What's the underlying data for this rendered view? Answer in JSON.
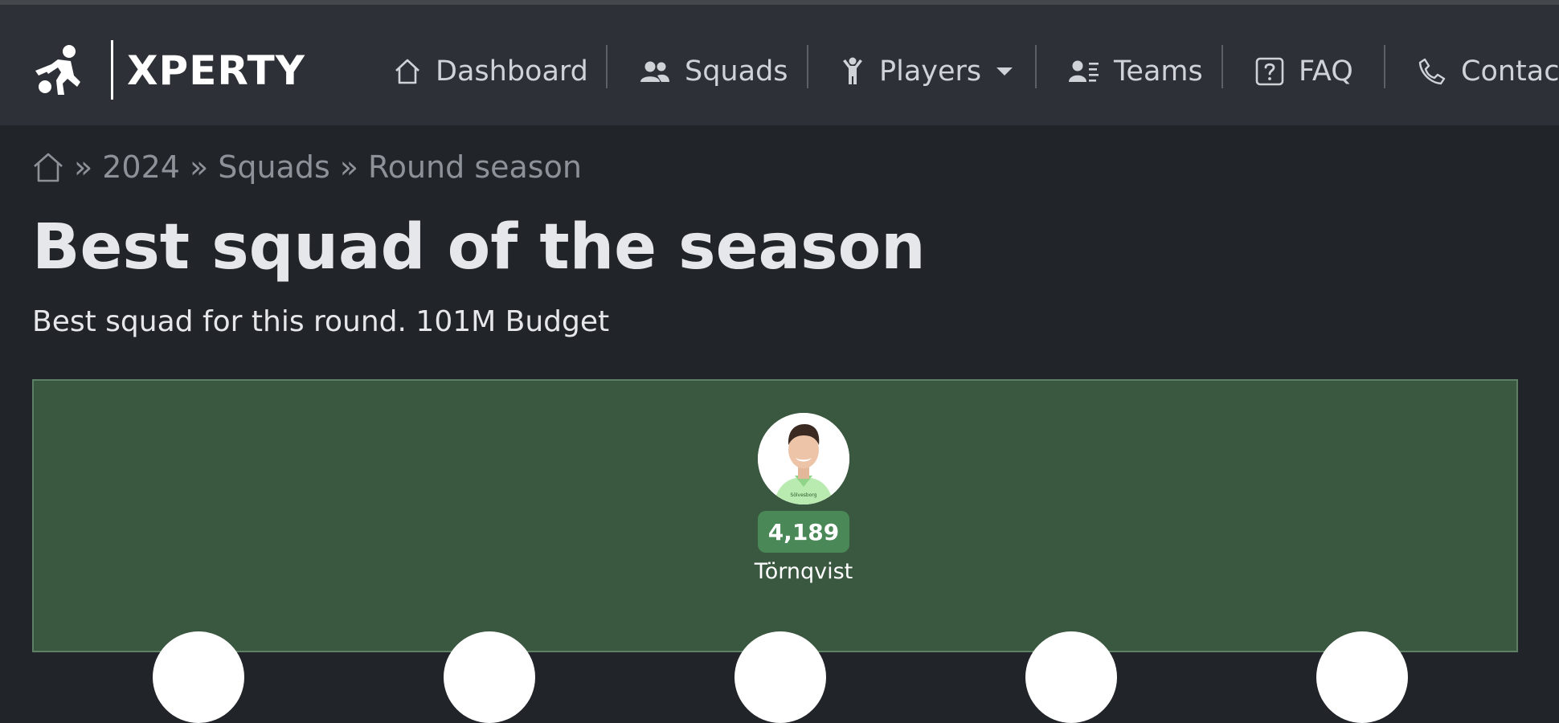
{
  "brand": {
    "name": "XPERTY",
    "logo_icon": "soccer-player-kick-icon"
  },
  "nav": {
    "items": [
      {
        "label": "Dashboard",
        "icon": "home-icon"
      },
      {
        "label": "Squads",
        "icon": "users-icon"
      },
      {
        "label": "Players",
        "icon": "person-icon",
        "dropdown_icon": "caret-down-icon"
      },
      {
        "label": "Teams",
        "icon": "user-list-icon"
      },
      {
        "label": "FAQ",
        "icon": "question-square-icon"
      },
      {
        "label": "Contact",
        "icon": "phone-icon"
      }
    ]
  },
  "breadcrumb": {
    "home_icon": "home-icon",
    "separator": "»",
    "items": [
      "2024",
      "Squads",
      "Round season"
    ]
  },
  "page": {
    "title": "Best squad of the season",
    "subtitle": "Best squad for this round. 101M Budget"
  },
  "pitch": {
    "goalkeeper": {
      "name": "Törnqvist",
      "points": "4,189",
      "kit_sponsor": "Sölvesborg"
    }
  },
  "colors": {
    "navbar": "#2d3036",
    "page_bg": "#212429",
    "pitch": "#3a5740",
    "points_badge": "#4a8857"
  }
}
